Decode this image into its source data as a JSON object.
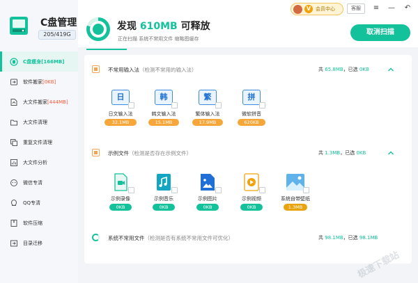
{
  "app": {
    "title": "C盘管理",
    "capacity": "205/419G"
  },
  "nav": [
    {
      "label_main": "C盘瘦身",
      "label_hl": "[166MB]",
      "icon": "broom-icon"
    },
    {
      "label_main": "软件搬家",
      "label_hl": "[0KB]",
      "icon": "box-move-icon"
    },
    {
      "label_main": "大文件搬家",
      "label_hl": "[444MB]",
      "icon": "file-move-icon"
    },
    {
      "label_main": "大文件清理",
      "label_hl": "",
      "icon": "folder-icon"
    },
    {
      "label_main": "重复文件清理",
      "label_hl": "",
      "icon": "duplicate-icon"
    },
    {
      "label_main": "大文件分析",
      "label_hl": "",
      "icon": "analysis-icon"
    },
    {
      "label_main": "微信专清",
      "label_hl": "",
      "icon": "wechat-icon"
    },
    {
      "label_main": "QQ专清",
      "label_hl": "",
      "icon": "qq-icon"
    },
    {
      "label_main": "软件压缩",
      "label_hl": "",
      "icon": "compress-icon"
    },
    {
      "label_main": "目录迁移",
      "label_hl": "",
      "icon": "migrate-icon"
    }
  ],
  "topbar": {
    "headline_prefix": "发现 ",
    "headline_amount": "610MB",
    "headline_suffix": " 可释放",
    "status": "正在扫描  系统不常用文件  缩略图缓存",
    "progress": 0.12,
    "member_badge": "V",
    "member_label": "会员中心",
    "service_label": "客服",
    "menu_icon": "≡",
    "minimize_icon": "—",
    "back_icon": "↶",
    "cancel_label": "取消扫描"
  },
  "sections": [
    {
      "title": "不常用输入法",
      "sub": "（检测不常用的输入法）",
      "total_label": "共 ",
      "total": "65.8MB",
      "selected_label": "，已选 ",
      "selected": "0KB",
      "items": [
        {
          "glyph": "日",
          "name": "日文输入法",
          "size": "32.1MB"
        },
        {
          "glyph": "韩",
          "name": "韩文输入法",
          "size": "15.1MB"
        },
        {
          "glyph": "繁",
          "name": "繁体输入法",
          "size": "17.9MB"
        },
        {
          "glyph": "拼",
          "name": "微软拼音",
          "size": "620KB"
        }
      ]
    },
    {
      "title": "示例文件",
      "sub": "（检测是否存在示例文件）",
      "total_label": "共 ",
      "total": "1.3MB",
      "selected_label": "，已选 ",
      "selected": "0KB",
      "items": [
        {
          "name": "示例录像",
          "size": "0KB"
        },
        {
          "name": "示例音乐",
          "size": "0KB"
        },
        {
          "name": "示例图片",
          "size": "0KB"
        },
        {
          "name": "示例视频",
          "size": "0KB"
        },
        {
          "name": "系统自带壁纸",
          "size": "1.3MB"
        }
      ]
    },
    {
      "title": "系统不常用文件",
      "sub": "（检测是否有系统不常用文件可优化）",
      "total_label": "共 ",
      "total": "98.1MB",
      "selected_label": "，已选 ",
      "selected": "98.1MB"
    }
  ],
  "watermark": "极速下载站",
  "colors": {
    "accent": "#13c29b",
    "highlight": "#ff5b3a",
    "orange": "#f7a63a",
    "blue": "#3d8be0"
  }
}
